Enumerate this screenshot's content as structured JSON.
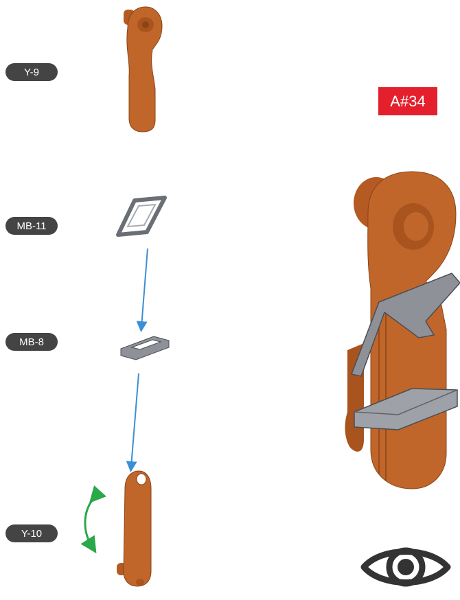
{
  "step": {
    "label": "A#34",
    "color": "#e3202b"
  },
  "parts": [
    {
      "id": "y9",
      "label": "Y-9"
    },
    {
      "id": "mb11",
      "label": "MB-11"
    },
    {
      "id": "mb8",
      "label": "MB-8"
    },
    {
      "id": "y10",
      "label": "Y-10"
    }
  ],
  "colors": {
    "wood": "#c0662a",
    "wood_dark": "#8a4416",
    "metal": "#8e9298",
    "metal_dark": "#4a4e55",
    "arrow_blue": "#3b8fd6",
    "arrow_green": "#2aa84a",
    "label_bg": "#444444"
  },
  "icons": [
    "eye-icon",
    "rotate-arrows-icon",
    "down-arrow-icon"
  ]
}
